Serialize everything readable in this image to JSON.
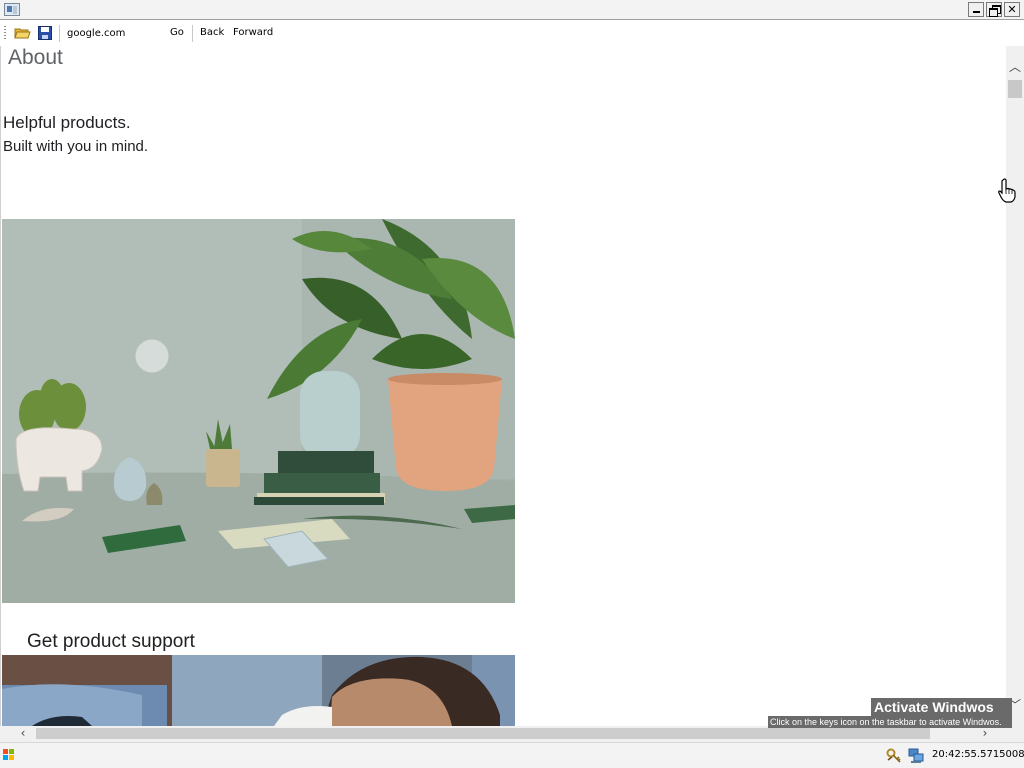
{
  "window": {
    "minimize_glyph": "",
    "maximize_glyph": "",
    "close_glyph": "✕"
  },
  "toolbar": {
    "address_value": "google.com",
    "go_label": "Go",
    "back_label": "Back",
    "forward_label": "Forward",
    "icons": [
      "open-folder-icon",
      "save-icon"
    ]
  },
  "page": {
    "about_heading": "About",
    "tagline_line1": "Helpful products.",
    "tagline_line2": "Built with you in mind.",
    "support_heading": "Get product support"
  },
  "scrollbars": {
    "up_glyph": "︿",
    "down_glyph": "﹀",
    "left_glyph": "‹",
    "right_glyph": "›"
  },
  "watermark": {
    "title": "Activate Windwos",
    "subtitle": "Click on the keys icon on the taskbar to activate Windwos."
  },
  "taskbar": {
    "clock": "20:42:55.5715008",
    "tray_icons": [
      "keys-icon",
      "network-icon"
    ]
  },
  "colors": {
    "heading_gray": "#5f6368",
    "text_dark": "#202124",
    "scene_wall": "#a7b5ae",
    "pot_terracotta": "#e1a47f",
    "watermark_bg": "#6a6a6a"
  }
}
